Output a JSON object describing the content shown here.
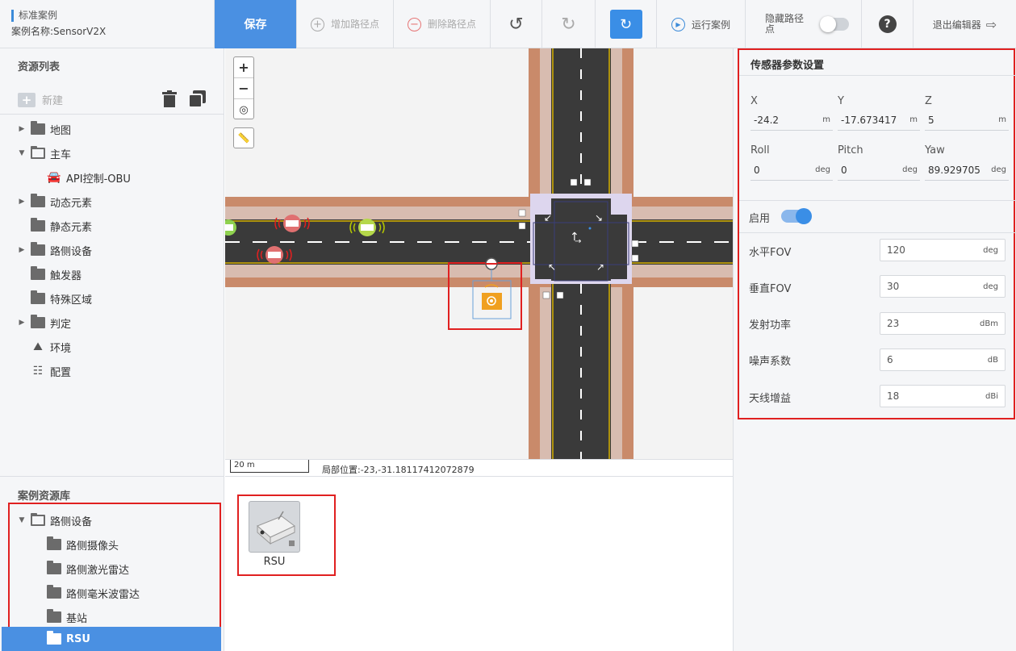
{
  "header": {
    "case_type": "标准案例",
    "case_name": "案例名称:SensorV2X",
    "save": "保存",
    "add_point": "增加路径点",
    "delete_point": "删除路径点",
    "undo_icon": "undo-icon",
    "redo_icon": "redo-icon",
    "run_case": "运行案例",
    "hide_path": "隐藏路径点",
    "hide_path_on": false,
    "help": "?",
    "exit_editor": "退出编辑器"
  },
  "resources": {
    "title": "资源列表",
    "new_label": "新建",
    "tree": [
      {
        "label": "地图",
        "caret": "▶",
        "icon": "folder"
      },
      {
        "label": "主车",
        "caret": "▼",
        "icon": "folder-open"
      },
      {
        "label": "API控制-OBU",
        "caret": "",
        "icon": "car"
      },
      {
        "label": "动态元素",
        "caret": "▶",
        "icon": "folder"
      },
      {
        "label": "静态元素",
        "caret": "",
        "icon": "folder"
      },
      {
        "label": "路侧设备",
        "caret": "▶",
        "icon": "folder"
      },
      {
        "label": "触发器",
        "caret": "",
        "icon": "folder"
      },
      {
        "label": "特殊区域",
        "caret": "",
        "icon": "folder"
      },
      {
        "label": "判定",
        "caret": "▶",
        "icon": "folder"
      },
      {
        "label": "环境",
        "caret": "",
        "icon": "environment"
      },
      {
        "label": "配置",
        "caret": "",
        "icon": "config"
      }
    ]
  },
  "library": {
    "title": "案例资源库",
    "items": [
      {
        "label": "路侧设备",
        "caret": "▼"
      },
      {
        "label": "路侧摄像头",
        "caret": ""
      },
      {
        "label": "路侧激光雷达",
        "caret": ""
      },
      {
        "label": "路侧毫米波雷达",
        "caret": ""
      },
      {
        "label": "基站",
        "caret": ""
      },
      {
        "label": "RSU",
        "caret": ""
      }
    ],
    "selected": "RSU"
  },
  "map": {
    "zoom_in": "+",
    "zoom_out": "−",
    "scale": "20 m",
    "local_position": "局部位置:-23,-31.18117412072879"
  },
  "resource_card": {
    "label": "RSU"
  },
  "params": {
    "title": "传感器参数设置",
    "x": {
      "label": "X",
      "value": "-24.2",
      "unit": "m"
    },
    "y": {
      "label": "Y",
      "value": "-17.673417",
      "unit": "m"
    },
    "z": {
      "label": "Z",
      "value": "5",
      "unit": "m"
    },
    "roll": {
      "label": "Roll",
      "value": "0",
      "unit": "deg"
    },
    "pitch": {
      "label": "Pitch",
      "value": "0",
      "unit": "deg"
    },
    "yaw": {
      "label": "Yaw",
      "value": "89.929705",
      "unit": "deg"
    },
    "enable_label": "启用",
    "enabled": true,
    "rows": [
      {
        "label": "水平FOV",
        "value": "120",
        "unit": "deg"
      },
      {
        "label": "垂直FOV",
        "value": "30",
        "unit": "deg"
      },
      {
        "label": "发射功率",
        "value": "23",
        "unit": "dBm"
      },
      {
        "label": "噪声系数",
        "value": "6",
        "unit": "dB"
      },
      {
        "label": "天线增益",
        "value": "18",
        "unit": "dBi"
      }
    ]
  },
  "colors": {
    "accent": "#4a90e2",
    "highlight_border": "#e02020",
    "road": "#3a3a3a",
    "sidewalk": "#c98a6a",
    "lane_yellow": "#d4b000"
  }
}
